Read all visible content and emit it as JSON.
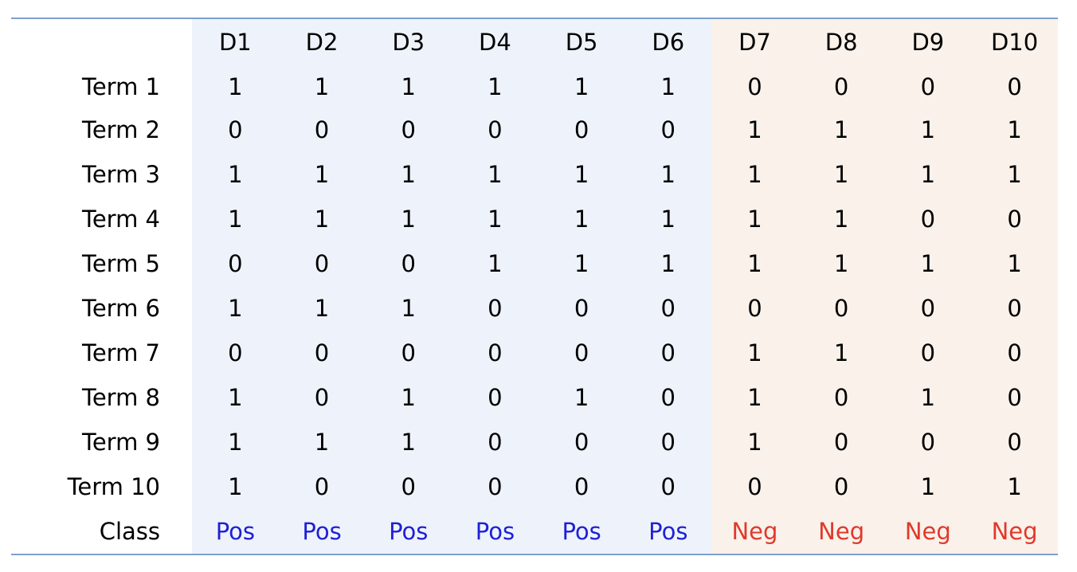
{
  "columns": [
    "D1",
    "D2",
    "D3",
    "D4",
    "D5",
    "D6",
    "D7",
    "D8",
    "D9",
    "D10"
  ],
  "rows": [
    {
      "label": "Term 1",
      "values": [
        "1",
        "1",
        "1",
        "1",
        "1",
        "1",
        "0",
        "0",
        "0",
        "0"
      ]
    },
    {
      "label": "Term 2",
      "values": [
        "0",
        "0",
        "0",
        "0",
        "0",
        "0",
        "1",
        "1",
        "1",
        "1"
      ]
    },
    {
      "label": "Term 3",
      "values": [
        "1",
        "1",
        "1",
        "1",
        "1",
        "1",
        "1",
        "1",
        "1",
        "1"
      ]
    },
    {
      "label": "Term 4",
      "values": [
        "1",
        "1",
        "1",
        "1",
        "1",
        "1",
        "1",
        "1",
        "0",
        "0"
      ]
    },
    {
      "label": "Term 5",
      "values": [
        "0",
        "0",
        "0",
        "1",
        "1",
        "1",
        "1",
        "1",
        "1",
        "1"
      ]
    },
    {
      "label": "Term 6",
      "values": [
        "1",
        "1",
        "1",
        "0",
        "0",
        "0",
        "0",
        "0",
        "0",
        "0"
      ]
    },
    {
      "label": "Term 7",
      "values": [
        "0",
        "0",
        "0",
        "0",
        "0",
        "0",
        "1",
        "1",
        "0",
        "0"
      ]
    },
    {
      "label": "Term 8",
      "values": [
        "1",
        "0",
        "1",
        "0",
        "1",
        "0",
        "1",
        "0",
        "1",
        "0"
      ]
    },
    {
      "label": "Term 9",
      "values": [
        "1",
        "1",
        "1",
        "0",
        "0",
        "0",
        "1",
        "0",
        "0",
        "0"
      ]
    },
    {
      "label": "Term 10",
      "values": [
        "1",
        "0",
        "0",
        "0",
        "0",
        "0",
        "0",
        "0",
        "1",
        "1"
      ]
    }
  ],
  "class_row": {
    "label": "Class",
    "values": [
      "Pos",
      "Pos",
      "Pos",
      "Pos",
      "Pos",
      "Pos",
      "Neg",
      "Neg",
      "Neg",
      "Neg"
    ]
  },
  "colors": {
    "rule": "#7f9fcf",
    "positive_band": "#eef3fb",
    "negative_band": "#f9f1ea",
    "positive_text": "#1f1fd6",
    "negative_text": "#e0392b"
  }
}
